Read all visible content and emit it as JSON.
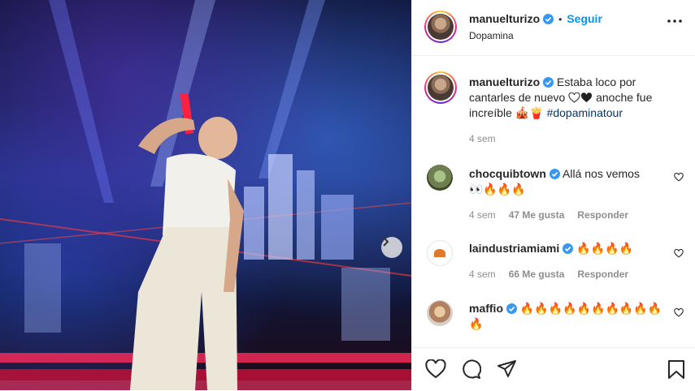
{
  "post": {
    "username": "manuelturizo",
    "follow_label": "Seguir",
    "separator": "•",
    "location": "Dopamina",
    "caption": "Estaba loco por cantarles de nuevo 🤍🖤 anoche fue increíble 🎪🎪🍟",
    "caption_text_1": "Estaba loco por cantarles de nuevo",
    "caption_text_2": "anoche fue increíble",
    "caption_emojis": "🎪🍟",
    "hashtag": "#dopaminatour",
    "caption_time": "4 sem"
  },
  "comments": [
    {
      "username": "chocquibtown",
      "text": "Allá nos vemos",
      "emojis": "👀🔥🔥🔥",
      "time": "4 sem",
      "likes": "47 Me gusta",
      "reply": "Responder"
    },
    {
      "username": "laindustriamiami",
      "text": "🔥🔥🔥🔥",
      "time": "4 sem",
      "likes": "66 Me gusta",
      "reply": "Responder"
    },
    {
      "username": "maffio",
      "text": "🔥🔥🔥🔥🔥🔥🔥🔥🔥🔥",
      "emojis": "🔥"
    }
  ],
  "colors": {
    "accent": "#0095f6",
    "text": "#262626",
    "muted": "#8e8e8e",
    "border": "#efefef",
    "verified": "#3897f0"
  },
  "icons": [
    "more-options-icon",
    "verified-icon",
    "heart-icon",
    "comment-icon",
    "share-icon",
    "bookmark-icon",
    "chevron-right-icon"
  ]
}
